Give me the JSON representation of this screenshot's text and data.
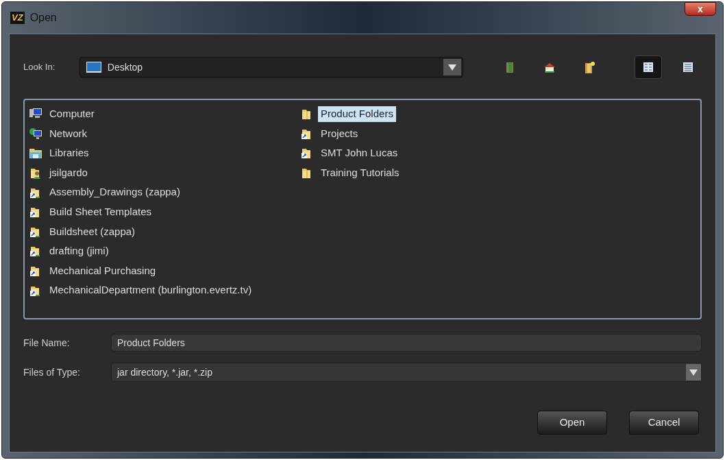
{
  "window": {
    "title": "Open",
    "logo": "VZ",
    "close": "x"
  },
  "look_in": {
    "label": "Look In:",
    "value": "Desktop"
  },
  "toolbar": [
    {
      "kind": "up",
      "selected": false
    },
    {
      "kind": "home",
      "selected": false
    },
    {
      "kind": "new-folder",
      "selected": false
    },
    {
      "kind": "list-view",
      "selected": true
    },
    {
      "kind": "details-view",
      "selected": false
    }
  ],
  "files": [
    {
      "name": "Computer",
      "kind": "computer",
      "selected": false
    },
    {
      "name": "Network",
      "kind": "network",
      "selected": false
    },
    {
      "name": "Libraries",
      "kind": "libraries",
      "selected": false
    },
    {
      "name": "jsilgardo",
      "kind": "user",
      "selected": false
    },
    {
      "name": "Assembly_Drawings (zappa)",
      "kind": "network-shortcut",
      "selected": false
    },
    {
      "name": "Build Sheet Templates",
      "kind": "shortcut",
      "selected": false
    },
    {
      "name": "Buildsheet (zappa)",
      "kind": "network-shortcut",
      "selected": false
    },
    {
      "name": "drafting (jimi)",
      "kind": "network-shortcut",
      "selected": false
    },
    {
      "name": "Mechanical Purchasing",
      "kind": "shortcut",
      "selected": false
    },
    {
      "name": "MechanicalDepartment (burlington.evertz.tv)",
      "kind": "network-shortcut",
      "selected": false
    },
    {
      "name": "Product Folders",
      "kind": "folder",
      "selected": true
    },
    {
      "name": "Projects",
      "kind": "shortcut",
      "selected": false
    },
    {
      "name": "SMT John Lucas",
      "kind": "shortcut",
      "selected": false
    },
    {
      "name": "Training Tutorials",
      "kind": "folder",
      "selected": false
    }
  ],
  "file_name": {
    "label": "File Name:",
    "value": "Product Folders"
  },
  "file_type": {
    "label": "Files of Type:",
    "value": "jar directory, *.jar, *.zip"
  },
  "buttons": [
    "Open",
    "Cancel"
  ]
}
